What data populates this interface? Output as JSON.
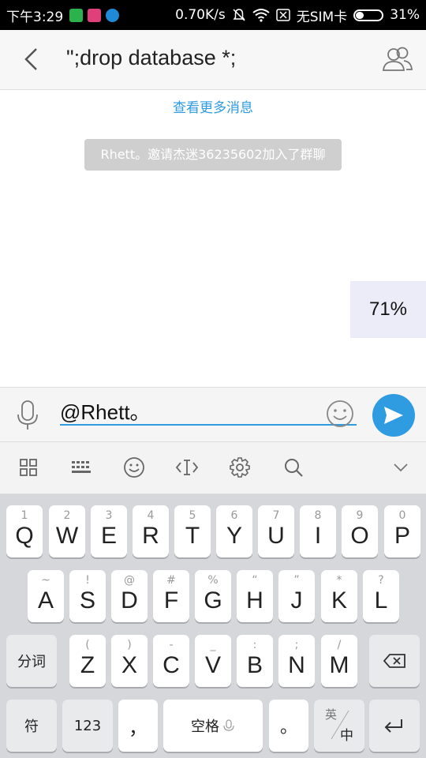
{
  "status_bar": {
    "time": "下午3:29",
    "speed": "0.70K/s",
    "sim": "无SIM卡",
    "battery_text": "31%",
    "battery_level": 0.31,
    "app_icon_colors": [
      "#2bb24c",
      "#e0407a",
      "#1f8ad6"
    ]
  },
  "header": {
    "title": "\";drop database *;",
    "back_icon": "back-arrow-icon",
    "members_icon": "group-members-icon"
  },
  "chat": {
    "load_more": "查看更多消息",
    "system_message": "Rhett。邀请杰迷36235602加入了群聊",
    "floating_badge": "71%"
  },
  "input_bar": {
    "value": "@Rhett。"
  },
  "keyboard_toolbar": {
    "icons": [
      "grid-icon",
      "keyboard-icon",
      "emoji-icon",
      "cursor-icon",
      "settings-icon",
      "search-icon",
      "collapse-chevron-icon"
    ]
  },
  "keyboard": {
    "row1": [
      {
        "main": "Q",
        "sub": "1"
      },
      {
        "main": "W",
        "sub": "2"
      },
      {
        "main": "E",
        "sub": "3"
      },
      {
        "main": "R",
        "sub": "4"
      },
      {
        "main": "T",
        "sub": "5"
      },
      {
        "main": "Y",
        "sub": "6"
      },
      {
        "main": "U",
        "sub": "7"
      },
      {
        "main": "I",
        "sub": "8"
      },
      {
        "main": "O",
        "sub": "9"
      },
      {
        "main": "P",
        "sub": "0"
      }
    ],
    "row2": [
      {
        "main": "A",
        "sub": "~"
      },
      {
        "main": "S",
        "sub": "!"
      },
      {
        "main": "D",
        "sub": "@"
      },
      {
        "main": "F",
        "sub": "#"
      },
      {
        "main": "G",
        "sub": "%"
      },
      {
        "main": "H",
        "sub": "“"
      },
      {
        "main": "J",
        "sub": "”"
      },
      {
        "main": "K",
        "sub": "*"
      },
      {
        "main": "L",
        "sub": "?"
      }
    ],
    "row3_left": "分词",
    "row3": [
      {
        "main": "Z",
        "sub": "("
      },
      {
        "main": "X",
        "sub": ")"
      },
      {
        "main": "C",
        "sub": "-"
      },
      {
        "main": "V",
        "sub": "_"
      },
      {
        "main": "B",
        "sub": ":"
      },
      {
        "main": "N",
        "sub": ";"
      },
      {
        "main": "M",
        "sub": "/"
      }
    ],
    "row4": {
      "symbol": "符",
      "numeric": "123",
      "comma": "，",
      "space": "空格",
      "period": "。",
      "lang_top": "英",
      "lang_bottom": "中"
    }
  }
}
